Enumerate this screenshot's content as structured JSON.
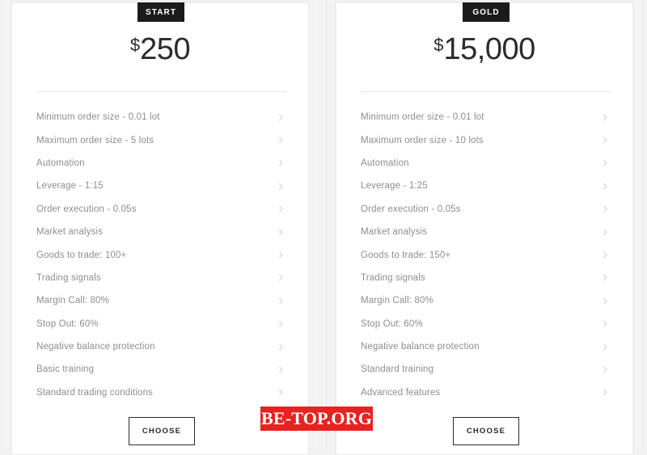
{
  "background_color": "#f2f2f2",
  "badge_color": "#1b1b1b",
  "accent_color": "#e8221f",
  "plans": [
    {
      "badge": "START",
      "currency": "$",
      "price": "250",
      "cta": "CHOOSE",
      "features": [
        "Minimum order size - 0.01 lot",
        "Maximum order size - 5 lots",
        "Automation",
        "Leverage - 1:15",
        "Order execution - 0.05s",
        "Market analysis",
        "Goods to trade: 100+",
        "Trading signals",
        "Margin Call: 80%",
        "Stop Out: 60%",
        "Negative balance protection",
        "Basic training",
        "Standard trading conditions"
      ]
    },
    {
      "badge": "GOLD",
      "currency": "$",
      "price": "15,000",
      "cta": "CHOOSE",
      "features": [
        "Minimum order size - 0.01 lot",
        "Maximum order size - 10 lots",
        "Automation",
        "Leverage - 1:25",
        "Order execution - 0.05s",
        "Market analysis",
        "Goods to trade: 150+",
        "Trading signals",
        "Margin Call: 80%",
        "Stop Out: 60%",
        "Negative balance protection",
        "Standard training",
        "Advanced features"
      ]
    }
  ],
  "watermark": {
    "text": "BE-TOP.ORG"
  },
  "icons": {
    "chevron": "chevron-right-icon"
  }
}
